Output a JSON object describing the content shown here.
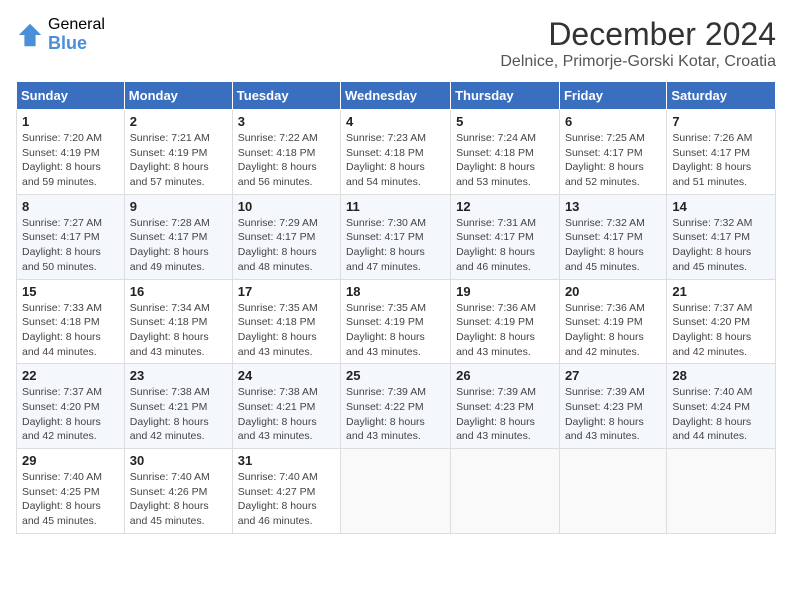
{
  "logo": {
    "general": "General",
    "blue": "Blue"
  },
  "title": {
    "month_year": "December 2024",
    "location": "Delnice, Primorje-Gorski Kotar, Croatia"
  },
  "weekdays": [
    "Sunday",
    "Monday",
    "Tuesday",
    "Wednesday",
    "Thursday",
    "Friday",
    "Saturday"
  ],
  "weeks": [
    [
      {
        "day": "1",
        "sunrise": "7:20 AM",
        "sunset": "4:19 PM",
        "daylight": "8 hours and 59 minutes."
      },
      {
        "day": "2",
        "sunrise": "7:21 AM",
        "sunset": "4:19 PM",
        "daylight": "8 hours and 57 minutes."
      },
      {
        "day": "3",
        "sunrise": "7:22 AM",
        "sunset": "4:18 PM",
        "daylight": "8 hours and 56 minutes."
      },
      {
        "day": "4",
        "sunrise": "7:23 AM",
        "sunset": "4:18 PM",
        "daylight": "8 hours and 54 minutes."
      },
      {
        "day": "5",
        "sunrise": "7:24 AM",
        "sunset": "4:18 PM",
        "daylight": "8 hours and 53 minutes."
      },
      {
        "day": "6",
        "sunrise": "7:25 AM",
        "sunset": "4:17 PM",
        "daylight": "8 hours and 52 minutes."
      },
      {
        "day": "7",
        "sunrise": "7:26 AM",
        "sunset": "4:17 PM",
        "daylight": "8 hours and 51 minutes."
      }
    ],
    [
      {
        "day": "8",
        "sunrise": "7:27 AM",
        "sunset": "4:17 PM",
        "daylight": "8 hours and 50 minutes."
      },
      {
        "day": "9",
        "sunrise": "7:28 AM",
        "sunset": "4:17 PM",
        "daylight": "8 hours and 49 minutes."
      },
      {
        "day": "10",
        "sunrise": "7:29 AM",
        "sunset": "4:17 PM",
        "daylight": "8 hours and 48 minutes."
      },
      {
        "day": "11",
        "sunrise": "7:30 AM",
        "sunset": "4:17 PM",
        "daylight": "8 hours and 47 minutes."
      },
      {
        "day": "12",
        "sunrise": "7:31 AM",
        "sunset": "4:17 PM",
        "daylight": "8 hours and 46 minutes."
      },
      {
        "day": "13",
        "sunrise": "7:32 AM",
        "sunset": "4:17 PM",
        "daylight": "8 hours and 45 minutes."
      },
      {
        "day": "14",
        "sunrise": "7:32 AM",
        "sunset": "4:17 PM",
        "daylight": "8 hours and 45 minutes."
      }
    ],
    [
      {
        "day": "15",
        "sunrise": "7:33 AM",
        "sunset": "4:18 PM",
        "daylight": "8 hours and 44 minutes."
      },
      {
        "day": "16",
        "sunrise": "7:34 AM",
        "sunset": "4:18 PM",
        "daylight": "8 hours and 43 minutes."
      },
      {
        "day": "17",
        "sunrise": "7:35 AM",
        "sunset": "4:18 PM",
        "daylight": "8 hours and 43 minutes."
      },
      {
        "day": "18",
        "sunrise": "7:35 AM",
        "sunset": "4:19 PM",
        "daylight": "8 hours and 43 minutes."
      },
      {
        "day": "19",
        "sunrise": "7:36 AM",
        "sunset": "4:19 PM",
        "daylight": "8 hours and 43 minutes."
      },
      {
        "day": "20",
        "sunrise": "7:36 AM",
        "sunset": "4:19 PM",
        "daylight": "8 hours and 42 minutes."
      },
      {
        "day": "21",
        "sunrise": "7:37 AM",
        "sunset": "4:20 PM",
        "daylight": "8 hours and 42 minutes."
      }
    ],
    [
      {
        "day": "22",
        "sunrise": "7:37 AM",
        "sunset": "4:20 PM",
        "daylight": "8 hours and 42 minutes."
      },
      {
        "day": "23",
        "sunrise": "7:38 AM",
        "sunset": "4:21 PM",
        "daylight": "8 hours and 42 minutes."
      },
      {
        "day": "24",
        "sunrise": "7:38 AM",
        "sunset": "4:21 PM",
        "daylight": "8 hours and 43 minutes."
      },
      {
        "day": "25",
        "sunrise": "7:39 AM",
        "sunset": "4:22 PM",
        "daylight": "8 hours and 43 minutes."
      },
      {
        "day": "26",
        "sunrise": "7:39 AM",
        "sunset": "4:23 PM",
        "daylight": "8 hours and 43 minutes."
      },
      {
        "day": "27",
        "sunrise": "7:39 AM",
        "sunset": "4:23 PM",
        "daylight": "8 hours and 43 minutes."
      },
      {
        "day": "28",
        "sunrise": "7:40 AM",
        "sunset": "4:24 PM",
        "daylight": "8 hours and 44 minutes."
      }
    ],
    [
      {
        "day": "29",
        "sunrise": "7:40 AM",
        "sunset": "4:25 PM",
        "daylight": "8 hours and 45 minutes."
      },
      {
        "day": "30",
        "sunrise": "7:40 AM",
        "sunset": "4:26 PM",
        "daylight": "8 hours and 45 minutes."
      },
      {
        "day": "31",
        "sunrise": "7:40 AM",
        "sunset": "4:27 PM",
        "daylight": "8 hours and 46 minutes."
      },
      null,
      null,
      null,
      null
    ]
  ],
  "labels": {
    "sunrise": "Sunrise:",
    "sunset": "Sunset:",
    "daylight": "Daylight:"
  }
}
